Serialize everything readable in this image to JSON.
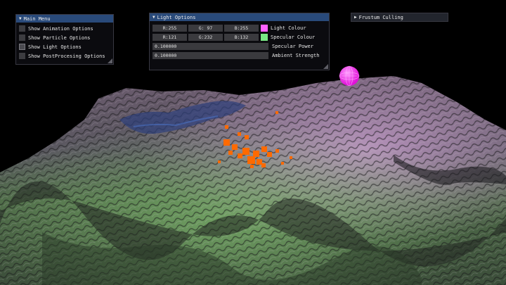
{
  "main_menu": {
    "title": "Main Menu",
    "items": [
      {
        "label": "Show Animation Options",
        "checked": false
      },
      {
        "label": "Show Particle Options",
        "checked": false
      },
      {
        "label": "Show Light Options",
        "checked": true
      },
      {
        "label": "Show PostProcesing Options",
        "checked": false
      }
    ]
  },
  "light_options": {
    "title": "Light Options",
    "light_colour": {
      "r": "R:255",
      "g": "G: 97",
      "b": "B:255",
      "label": "Light Colour",
      "swatch": "#ff61ff"
    },
    "specular_colour": {
      "r": "R:121",
      "g": "G:232",
      "b": "B:132",
      "label": "Specular Colour",
      "swatch": "#79e884"
    },
    "specular_power": {
      "value": "0.100000",
      "label": "Specular Power"
    },
    "ambient_strength": {
      "value": "0.100000",
      "label": "Ambient Strength"
    }
  },
  "frustum_culling": {
    "title": "Frustum Culling"
  },
  "colors": {
    "titlebar_active": "#294a7a",
    "light_sphere": "#ff3cf0",
    "particles": "#ff6a00"
  }
}
